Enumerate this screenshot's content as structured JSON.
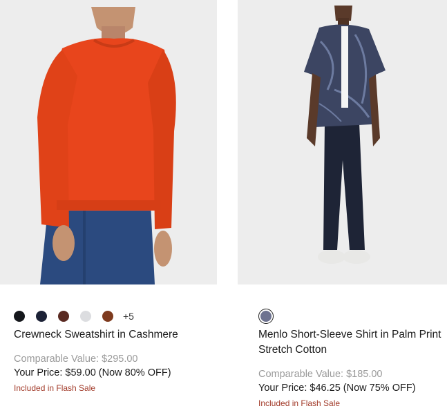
{
  "products": [
    {
      "name": "Crewneck Sweatshirt in Cashmere",
      "swatches": [
        "#15171c",
        "#1c2236",
        "#5a2a22",
        "#dcdde0",
        "#7e3a1e"
      ],
      "more_swatches": "+5",
      "comparable": "Comparable Value: $295.00",
      "price": "Your Price: $59.00 (Now 80% OFF)",
      "flash": "Included in Flash Sale",
      "image": "orange-sweater-photo"
    },
    {
      "name": "Menlo Short-Sleeve Shirt in Palm Print Stretch Cotton",
      "swatches": [
        "#6e7390"
      ],
      "comparable": "Comparable Value: $185.00",
      "price": "Your Price: $46.25 (Now 75% OFF)",
      "flash": "Included in Flash Sale",
      "image": "palm-print-shirt-photo"
    }
  ],
  "colors": {
    "flash": "#a23b2a",
    "comparable": "#9a9a9a",
    "photo_bg": "#ededed"
  }
}
